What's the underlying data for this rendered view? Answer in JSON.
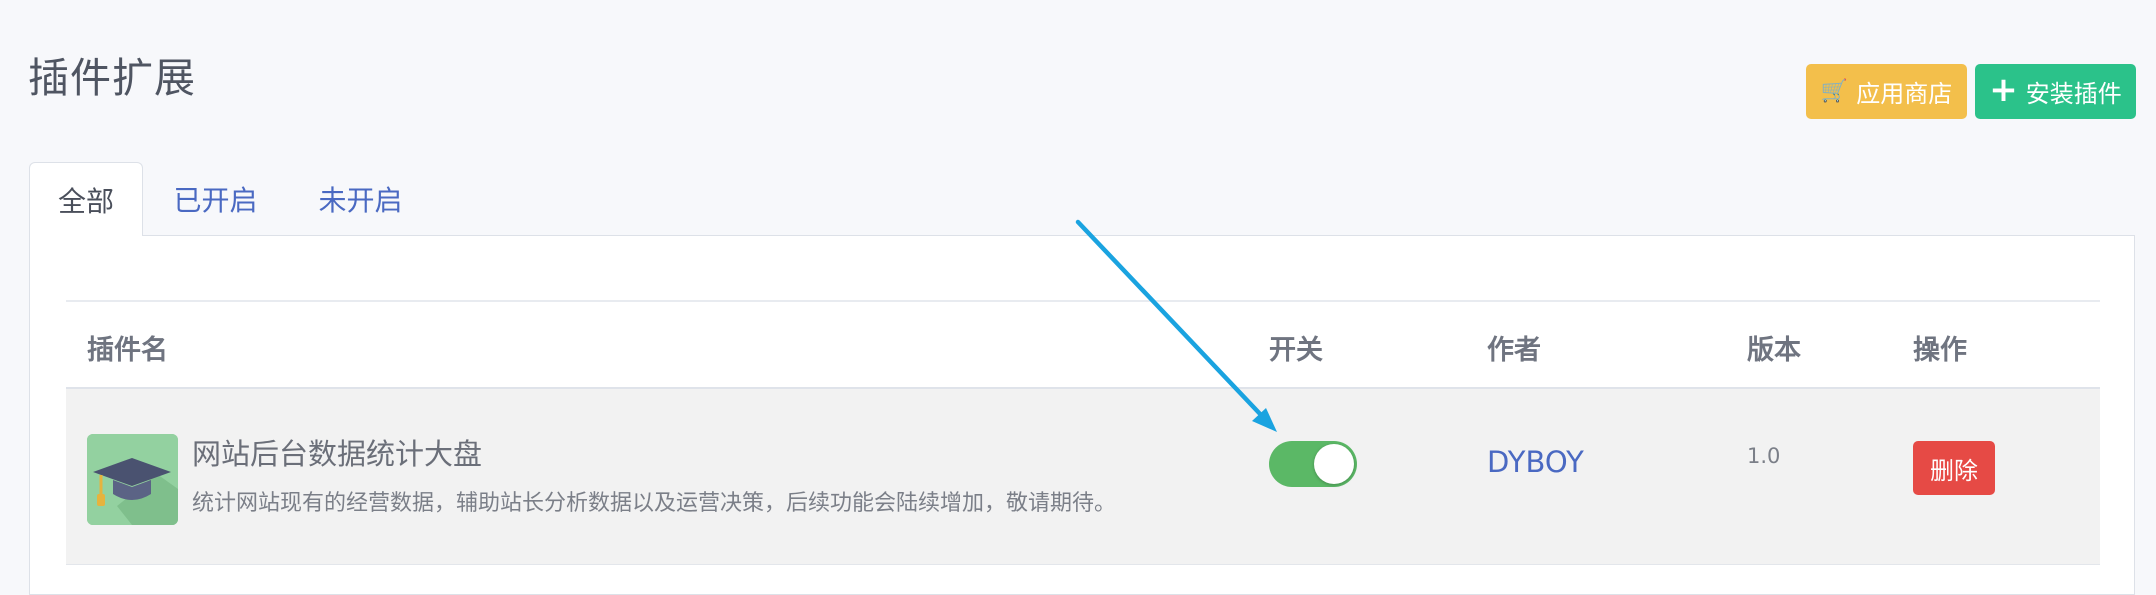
{
  "page": {
    "title": "插件扩展"
  },
  "toolbar": {
    "store_label": "应用商店",
    "install_label": "安装插件",
    "store_icon": "cart-icon",
    "install_icon": "plus-icon"
  },
  "tabs": [
    {
      "label": "全部",
      "active": true
    },
    {
      "label": "已开启",
      "active": false
    },
    {
      "label": "未开启",
      "active": false
    }
  ],
  "table": {
    "headers": {
      "name": "插件名",
      "switch": "开关",
      "author": "作者",
      "version": "版本",
      "ops": "操作"
    },
    "rows": [
      {
        "icon": "graduation-cap-icon",
        "name": "网站后台数据统计大盘",
        "description": "统计网站现有的经营数据，辅助站长分析数据以及运营决策，后续功能会陆续增加，敬请期待。",
        "enabled": true,
        "author": "DYBOY",
        "version": "1.0",
        "delete_label": "删除"
      }
    ]
  },
  "colors": {
    "store_button": "#f3bf4b",
    "install_button": "#2bc28a",
    "toggle_on": "#5bb866",
    "delete_button": "#e64a45",
    "link": "#4a69c2",
    "annotation_arrow": "#1aa3e0"
  }
}
